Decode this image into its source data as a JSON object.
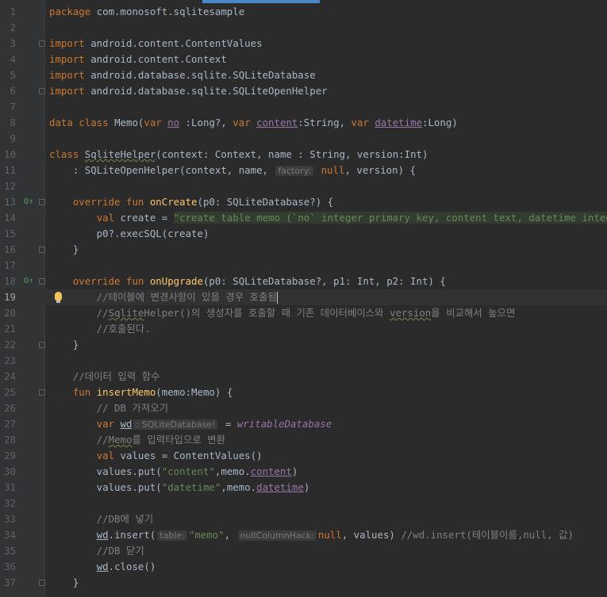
{
  "editor": {
    "lines": [
      {
        "n": "1",
        "t": [
          {
            "c": "kw",
            "v": "package "
          },
          {
            "v": "com.monosoft.sqlitesample"
          }
        ]
      },
      {
        "n": "2",
        "t": []
      },
      {
        "n": "3",
        "fold": true,
        "t": [
          {
            "c": "kw",
            "v": "import "
          },
          {
            "v": "android.content.ContentValues"
          }
        ]
      },
      {
        "n": "4",
        "t": [
          {
            "c": "kw",
            "v": "import "
          },
          {
            "v": "android.content.Context"
          }
        ]
      },
      {
        "n": "5",
        "t": [
          {
            "c": "kw",
            "v": "import "
          },
          {
            "v": "android.database.sqlite.SQLiteDatabase"
          }
        ]
      },
      {
        "n": "6",
        "fold": true,
        "t": [
          {
            "c": "kw",
            "v": "import "
          },
          {
            "v": "android.database.sqlite.SQLiteOpenHelper"
          }
        ]
      },
      {
        "n": "7",
        "t": []
      },
      {
        "n": "8",
        "t": [
          {
            "c": "kw",
            "v": "data class "
          },
          {
            "v": "Memo("
          },
          {
            "c": "kw",
            "v": "var "
          },
          {
            "c": "prop ul",
            "v": "no"
          },
          {
            "v": " :Long?, "
          },
          {
            "c": "kw",
            "v": "var "
          },
          {
            "c": "prop ul",
            "v": "content"
          },
          {
            "v": ":String, "
          },
          {
            "c": "kw",
            "v": "var "
          },
          {
            "c": "prop ul",
            "v": "datetime"
          },
          {
            "v": ":Long)"
          }
        ]
      },
      {
        "n": "9",
        "t": []
      },
      {
        "n": "10",
        "t": [
          {
            "c": "kw",
            "v": "class "
          },
          {
            "c": "wavy",
            "v": "SqliteHelper"
          },
          {
            "v": "(context: Context, name : String, version:Int)"
          }
        ]
      },
      {
        "n": "11",
        "t": [
          {
            "v": "    : SQLiteOpenHelper(context, name, "
          },
          {
            "c": "hint",
            "v": "factory:"
          },
          {
            "c": "kw",
            "v": " null"
          },
          {
            "v": ", version) {"
          }
        ]
      },
      {
        "n": "12",
        "t": []
      },
      {
        "n": "13",
        "icon": "override",
        "fold": true,
        "t": [
          {
            "v": "    "
          },
          {
            "c": "kw",
            "v": "override fun "
          },
          {
            "c": "fn",
            "v": "onCreate"
          },
          {
            "v": "(p0: SQLiteDatabase?) {"
          }
        ]
      },
      {
        "n": "14",
        "t": [
          {
            "v": "        "
          },
          {
            "c": "kw",
            "v": "val "
          },
          {
            "v": "create = "
          },
          {
            "c": "str strbg",
            "v": "\"create table memo (`no` integer primary key, content text, datetime integer)\""
          }
        ]
      },
      {
        "n": "15",
        "t": [
          {
            "v": "        p0?.execSQL(create)"
          }
        ]
      },
      {
        "n": "16",
        "fold": true,
        "t": [
          {
            "v": "    }"
          }
        ]
      },
      {
        "n": "17",
        "t": []
      },
      {
        "n": "18",
        "icon": "override",
        "fold": true,
        "t": [
          {
            "v": "    "
          },
          {
            "c": "kw",
            "v": "override fun "
          },
          {
            "c": "fn",
            "v": "onUpgrade"
          },
          {
            "v": "(p0: SQLiteDatabase?, p1: Int, p2: Int) {"
          }
        ]
      },
      {
        "n": "19",
        "current": true,
        "bulb": true,
        "t": [
          {
            "c": "cm",
            "v": "        //테이블에 변경사항이 있을 경우 호출됨"
          },
          {
            "c": "caret",
            "v": ""
          }
        ]
      },
      {
        "n": "20",
        "t": [
          {
            "c": "cm",
            "v": "        //"
          },
          {
            "c": "cm wavy",
            "v": "Sqlite"
          },
          {
            "c": "cm",
            "v": "Helper()의 생성자를 호출할 때 기존 데이터베이스와 "
          },
          {
            "c": "cm wavy",
            "v": "version"
          },
          {
            "c": "cm",
            "v": "을 비교해서 높으면"
          }
        ]
      },
      {
        "n": "21",
        "t": [
          {
            "c": "cm",
            "v": "        //호출된다."
          }
        ]
      },
      {
        "n": "22",
        "fold": true,
        "t": [
          {
            "v": "    }"
          }
        ]
      },
      {
        "n": "23",
        "t": []
      },
      {
        "n": "24",
        "t": [
          {
            "c": "cm",
            "v": "    //데이터 입력 함수"
          }
        ]
      },
      {
        "n": "25",
        "fold": true,
        "t": [
          {
            "v": "    "
          },
          {
            "c": "kw",
            "v": "fun "
          },
          {
            "c": "fn",
            "v": "insertMemo"
          },
          {
            "v": "(memo:Memo) {"
          }
        ]
      },
      {
        "n": "26",
        "t": [
          {
            "c": "cm",
            "v": "        // DB 가져오기"
          }
        ]
      },
      {
        "n": "27",
        "t": [
          {
            "v": "        "
          },
          {
            "c": "kw",
            "v": "var "
          },
          {
            "c": "ul",
            "v": "wd"
          },
          {
            "c": "hint",
            "v": ": SQLiteDatabase!"
          },
          {
            "v": " = "
          },
          {
            "c": "iprop",
            "v": "writableDatabase"
          }
        ]
      },
      {
        "n": "28",
        "t": [
          {
            "c": "cm",
            "v": "        //"
          },
          {
            "c": "cm wavy",
            "v": "Memo"
          },
          {
            "c": "cm",
            "v": "를 입력타입으로 변환"
          }
        ]
      },
      {
        "n": "29",
        "t": [
          {
            "v": "        "
          },
          {
            "c": "kw",
            "v": "val "
          },
          {
            "v": "values = ContentValues()"
          }
        ]
      },
      {
        "n": "30",
        "t": [
          {
            "v": "        values.put("
          },
          {
            "c": "str",
            "v": "\"content\""
          },
          {
            "v": ",memo."
          },
          {
            "c": "prop ul",
            "v": "content"
          },
          {
            "v": ")"
          }
        ]
      },
      {
        "n": "31",
        "t": [
          {
            "v": "        values.put("
          },
          {
            "c": "str",
            "v": "\"datetime\""
          },
          {
            "v": ",memo."
          },
          {
            "c": "prop ul",
            "v": "datetime"
          },
          {
            "v": ")"
          }
        ]
      },
      {
        "n": "32",
        "t": []
      },
      {
        "n": "33",
        "t": [
          {
            "c": "cm",
            "v": "        //DB에 넣기"
          }
        ]
      },
      {
        "n": "34",
        "t": [
          {
            "v": "        "
          },
          {
            "c": "ul",
            "v": "wd"
          },
          {
            "v": ".insert("
          },
          {
            "c": "hint",
            "v": "table:"
          },
          {
            "c": "str",
            "v": "\"memo\""
          },
          {
            "v": ", "
          },
          {
            "c": "hint",
            "v": "nullColumnHack:"
          },
          {
            "c": "kw",
            "v": "null"
          },
          {
            "v": ", values) "
          },
          {
            "c": "cm",
            "v": "//wd.insert(테이블이름,null, 값)"
          }
        ]
      },
      {
        "n": "35",
        "t": [
          {
            "c": "cm",
            "v": "        //DB 닫기"
          }
        ]
      },
      {
        "n": "36",
        "t": [
          {
            "v": "        "
          },
          {
            "c": "ul",
            "v": "wd"
          },
          {
            "v": ".close()"
          }
        ]
      },
      {
        "n": "37",
        "fold": true,
        "t": [
          {
            "v": "    }"
          }
        ]
      }
    ]
  },
  "colors": {
    "background": "#2b2b2b",
    "keyword": "#cc7832",
    "string": "#6a8759",
    "comment": "#808080",
    "function": "#ffc66d",
    "property": "#9876aa",
    "text": "#a9b7c6"
  }
}
